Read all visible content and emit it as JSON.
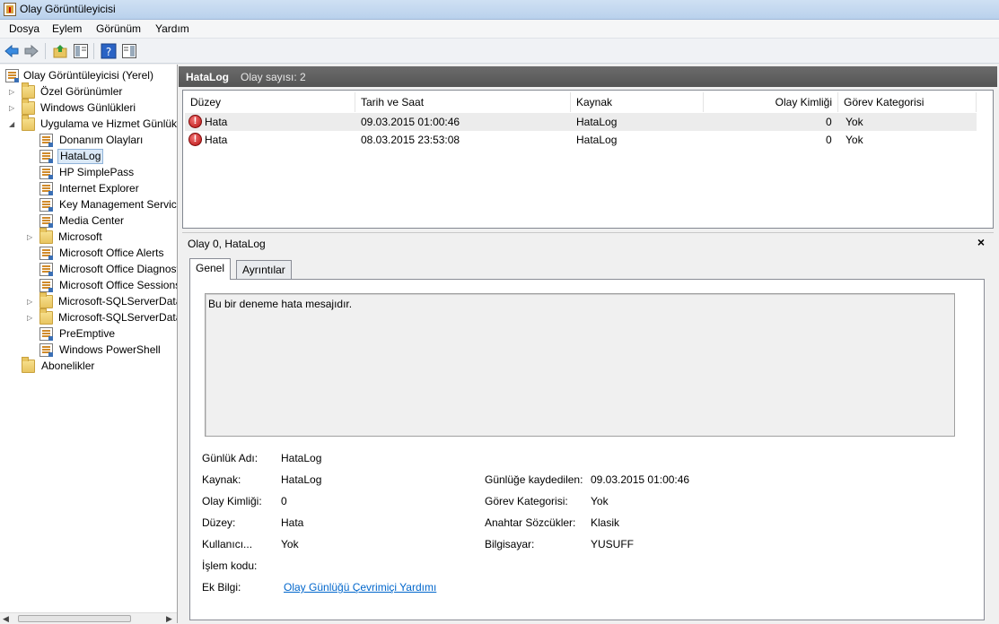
{
  "window": {
    "title": "Olay Görüntüleyicisi"
  },
  "menu": [
    "Dosya",
    "Eylem",
    "Görünüm",
    "Yardım"
  ],
  "tree": {
    "root": "Olay Görüntüleyicisi (Yerel)",
    "items": [
      "Özel Görünümler",
      "Windows Günlükleri",
      "Uygulama ve Hizmet Günlükleri",
      "Donanım Olayları",
      "HataLog",
      "HP SimplePass",
      "Internet Explorer",
      "Key Management Service",
      "Media Center",
      "Microsoft",
      "Microsoft Office Alerts",
      "Microsoft Office Diagnostics",
      "Microsoft Office Sessions",
      "Microsoft-SQLServerDataTools",
      "Microsoft-SQLServerDataToolsVS",
      "PreEmptive",
      "Windows PowerShell",
      "Abonelikler"
    ]
  },
  "header": {
    "log_name": "HataLog",
    "count_text": "Olay sayısı: 2"
  },
  "columns": [
    "Düzey",
    "Tarih ve Saat",
    "Kaynak",
    "Olay Kimliği",
    "Görev Kategorisi"
  ],
  "events": [
    {
      "level": "Hata",
      "datetime": "09.03.2015 01:00:46",
      "source": "HataLog",
      "id": "0",
      "category": "Yok"
    },
    {
      "level": "Hata",
      "datetime": "08.03.2015 23:53:08",
      "source": "HataLog",
      "id": "0",
      "category": "Yok"
    }
  ],
  "detail": {
    "title": "Olay 0, HataLog",
    "close": "×",
    "tabs": [
      "Genel",
      "Ayrıntılar"
    ],
    "message": "Bu bir deneme hata mesajıdır.",
    "fields": {
      "log_name_label": "Günlük Adı:",
      "log_name": "HataLog",
      "source_label": "Kaynak:",
      "source": "HataLog",
      "event_id_label": "Olay Kimliği:",
      "event_id": "0",
      "level_label": "Düzey:",
      "level": "Hata",
      "user_label": "Kullanıcı...",
      "user": "Yok",
      "opcode_label": "İşlem kodu:",
      "more_info_label": "Ek Bilgi:",
      "more_info_link": "Olay Günlüğü Çevrimiçi Yardımı",
      "logged_label": "Günlüğe kaydedilen:",
      "logged": "09.03.2015 01:00:46",
      "task_label": "Görev Kategorisi:",
      "task": "Yok",
      "keywords_label": "Anahtar Sözcükler:",
      "keywords": "Klasik",
      "computer_label": "Bilgisayar:",
      "computer": "YUSUFF"
    }
  }
}
